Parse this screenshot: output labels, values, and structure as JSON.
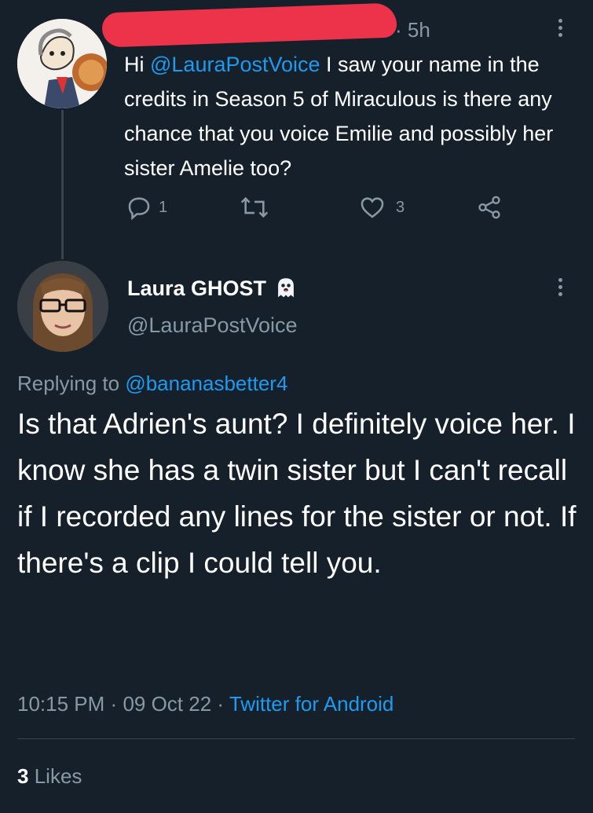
{
  "original_tweet": {
    "time": "5h",
    "text_parts": {
      "prefix": "Hi ",
      "mention": "@LauraPostVoice",
      "body": " I saw your name in the credits in Season 5 of Miraculous is there any chance that you voice Emilie and possibly her sister Amelie too?"
    },
    "actions": {
      "reply_count": "1",
      "like_count": "3"
    }
  },
  "reply_tweet": {
    "display_name": "Laura GHOST",
    "handle": "@LauraPostVoice",
    "replying_to_label": "Replying to",
    "replying_to_handle": "@bananasbetter4",
    "text": "Is that Adrien's aunt? I definitely voice her. I know she has a twin sister but I can't recall if I recorded any lines for the sister or not. If there's a clip I could tell you.",
    "time": "10:15 PM",
    "date": "09 Oct 22",
    "source": "Twitter for Android",
    "separator": "·",
    "likes_count": "3",
    "likes_label": "Likes"
  },
  "icons": {
    "more": "more-vertical-icon",
    "reply": "reply-icon",
    "retweet": "retweet-icon",
    "like": "like-icon",
    "share": "share-icon",
    "ghost": "ghost-emoji-icon"
  },
  "colors": {
    "background": "#15202b",
    "link": "#1d9bf0",
    "muted": "#8899a6",
    "redaction": "#ed3349"
  }
}
